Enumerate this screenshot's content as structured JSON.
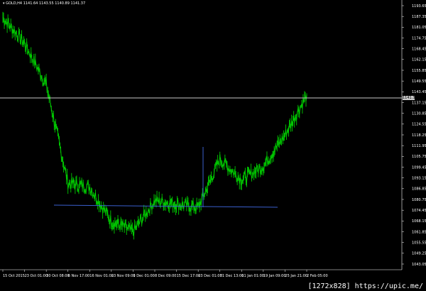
{
  "header": {
    "symbol": "GOLD,H4",
    "ohlc": "1141.64 1143.55 1140.89 1141.37"
  },
  "price_axis": {
    "ticks": [
      "1193.65",
      "1187.35",
      "1181.05",
      "1174.75",
      "1168.45",
      "1162.15",
      "1155.85",
      "1149.55",
      "1143.45",
      "1137.15",
      "1130.85",
      "1124.55",
      "1118.25",
      "1111.95",
      "1105.75",
      "1099.45",
      "1093.15",
      "1086.85",
      "1080.75",
      "1074.45",
      "1068.15",
      "1061.85",
      "1055.55",
      "1049.25",
      "1043.05"
    ],
    "current_price": "1141.37"
  },
  "time_axis": {
    "ticks": [
      "15 Oct 2015",
      "23 Oct 01:00",
      "30 Oct 08:00",
      "6 Nov 17:00",
      "16 Nov 01:00",
      "23 Nov 09:00",
      "1 Dec 01:00",
      "8 Dec 09:00",
      "15 Dec 17:00",
      "23 Dec 01:00",
      "31 Dec 13:00",
      "11 Jan 01:00",
      "19 Jan 09:00",
      "25 Jan 21:00",
      "2 Feb 05:00"
    ]
  },
  "watermark": "[1272x828] https://upic.me/",
  "colors": {
    "background": "#000000",
    "candles": "#00c800",
    "grid_line": "#c8c8c8",
    "trend_lines": "#3a5fcd",
    "price_tag_bg": "#c8c8c8"
  },
  "chart_data": {
    "type": "line",
    "symbol": "GOLD",
    "timeframe": "H4",
    "x": [
      "15 Oct 2015",
      "23 Oct 01:00",
      "30 Oct 08:00",
      "6 Nov 17:00",
      "16 Nov 01:00",
      "23 Nov 09:00",
      "1 Dec 01:00",
      "8 Dec 09:00",
      "15 Dec 17:00",
      "23 Dec 01:00",
      "31 Dec 13:00",
      "11 Jan 01:00",
      "19 Jan 09:00",
      "25 Jan 21:00",
      "2 Feb 05:00"
    ],
    "series": [
      {
        "values": [
          1186,
          1171,
          1147,
          1090,
          1088,
          1068,
          1062,
          1080,
          1078,
          1076,
          1104,
          1092,
          1100,
          1118,
          1141
        ]
      }
    ],
    "ylim": [
      1040,
      1196
    ],
    "grid": false,
    "reference_line": 1141.37,
    "support_line": 1085.5
  }
}
